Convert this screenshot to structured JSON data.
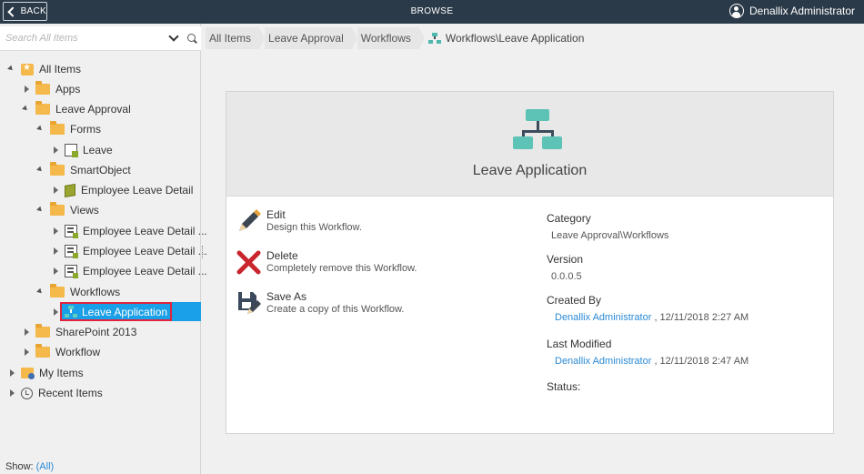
{
  "topbar": {
    "back_label": "BACK",
    "title": "BROWSE",
    "user_name": "Denallix Administrator"
  },
  "search": {
    "placeholder": "Search All Items"
  },
  "tree": {
    "all_items": "All Items",
    "apps": "Apps",
    "leave_approval": "Leave Approval",
    "forms": "Forms",
    "leave_form": "Leave",
    "smartobject": "SmartObject",
    "employee_leave_detail": "Employee Leave Detail",
    "views": "Views",
    "view_1": "Employee Leave Detail ...",
    "view_2": "Employee Leave Detail ...",
    "view_3": "Employee Leave Detail ...",
    "workflows": "Workflows",
    "leave_application": "Leave Application",
    "sharepoint": "SharePoint 2013",
    "workflow": "Workflow",
    "my_items": "My Items",
    "recent_items": "Recent Items"
  },
  "show": {
    "label": "Show:",
    "value": "(All)"
  },
  "breadcrumb": {
    "items": [
      "All Items",
      "Leave Approval",
      "Workflows"
    ],
    "current": "Workflows\\Leave Application"
  },
  "card": {
    "title": "Leave Application",
    "actions": [
      {
        "name": "Edit",
        "desc": "Design this Workflow."
      },
      {
        "name": "Delete",
        "desc": "Completely remove this Workflow."
      },
      {
        "name": "Save As",
        "desc": "Create a copy of this Workflow."
      }
    ],
    "category_label": "Category",
    "category_value": "Leave Approval\\Workflows",
    "version_label": "Version",
    "version_value": "0.0.0.5",
    "created_by_label": "Created By",
    "created_by_user": "Denallix Administrator",
    "created_by_date": ", 12/11/2018 2:27 AM",
    "modified_label": "Last Modified",
    "modified_user": "Denallix Administrator",
    "modified_date": ", 12/11/2018 2:47 AM",
    "status_label": "Status:"
  },
  "colors": {
    "topbar": "#2b3a48",
    "selection": "#1aa0e8",
    "highlight_border": "#e0243b",
    "link": "#2a8ad4",
    "workflow_teal": "#5ec3b7"
  }
}
